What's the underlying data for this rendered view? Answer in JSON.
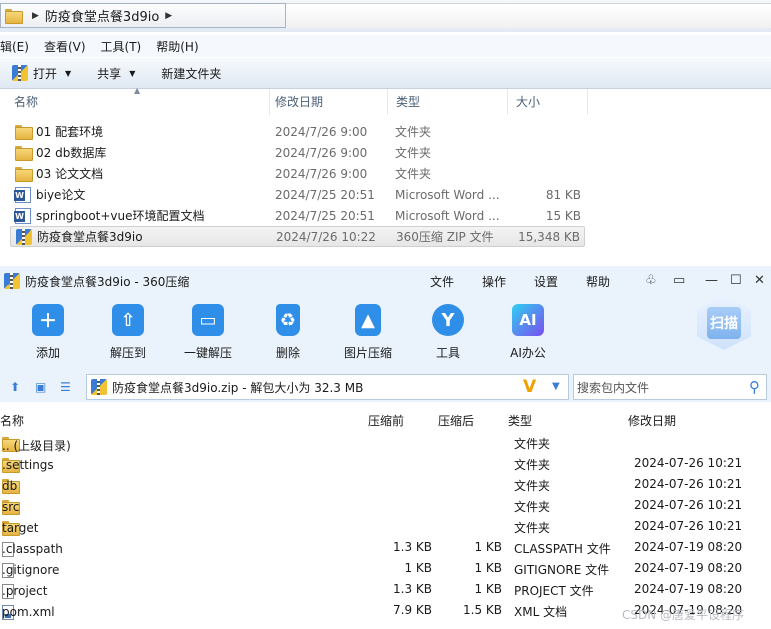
{
  "explorer": {
    "path": "防疫食堂点餐3d9io",
    "menu": [
      "辑(E)",
      "查看(V)",
      "工具(T)",
      "帮助(H)"
    ],
    "toolbar": {
      "open": "打开",
      "share": "共享",
      "new_folder": "新建文件夹"
    },
    "columns": {
      "name": "名称",
      "date": "修改日期",
      "type": "类型",
      "size": "大小"
    },
    "files": [
      {
        "name": "01 配套环境",
        "date": "2024/7/26 9:00",
        "type": "文件夹",
        "size": "",
        "icon": "folder-icon"
      },
      {
        "name": "02 db数据库",
        "date": "2024/7/26 9:00",
        "type": "文件夹",
        "size": "",
        "icon": "folder-icon"
      },
      {
        "name": "03 论文文档",
        "date": "2024/7/26 9:00",
        "type": "文件夹",
        "size": "",
        "icon": "folder-icon"
      },
      {
        "name": "biye论文",
        "date": "2024/7/25 20:51",
        "type": "Microsoft Word ...",
        "size": "81 KB",
        "icon": "word-icon"
      },
      {
        "name": "springboot+vue环境配置文档",
        "date": "2024/7/25 20:51",
        "type": "Microsoft Word ...",
        "size": "15 KB",
        "icon": "word-icon"
      },
      {
        "name": "防疫食堂点餐3d9io",
        "date": "2024/7/26 10:22",
        "type": "360压缩 ZIP 文件",
        "size": "15,348 KB",
        "icon": "zip-icon"
      }
    ]
  },
  "zip_window": {
    "title": "防疫食堂点餐3d9io - 360压缩",
    "menu": [
      "文件",
      "操作",
      "设置",
      "帮助"
    ],
    "tools": [
      {
        "label": "添加",
        "icon": "add-icon",
        "color": "#2f8fe8"
      },
      {
        "label": "解压到",
        "icon": "extract-icon",
        "color": "#2f8fe8"
      },
      {
        "label": "一键解压",
        "icon": "one-click-extract-icon",
        "color": "#2f8fe8"
      },
      {
        "label": "删除",
        "icon": "trash-icon",
        "color": "#2f8fe8"
      },
      {
        "label": "图片压缩",
        "icon": "image-compress-icon",
        "color": "#2f8fe8"
      },
      {
        "label": "工具",
        "icon": "tools-icon",
        "color": "#2f8fe8"
      },
      {
        "label": "AI办公",
        "icon": "ai-icon",
        "color": "#6a5cf2"
      }
    ],
    "scan_label": "扫描",
    "path_text": "防疫食堂点餐3d9io.zip - 解包大小为 32.3 MB",
    "vip_text": "V",
    "search_placeholder": "搜索包内文件",
    "columns": {
      "name": "名称",
      "before": "压缩前",
      "after": "压缩后",
      "type": "类型",
      "modified": "修改日期"
    },
    "entries": [
      {
        "name": ".. (上级目录)",
        "before": "",
        "after": "",
        "type": "文件夹",
        "modified": "",
        "icon": "folder-icon"
      },
      {
        "name": ".settings",
        "before": "",
        "after": "",
        "type": "文件夹",
        "modified": "2024-07-26 10:21",
        "icon": "folder-icon"
      },
      {
        "name": "db",
        "before": "",
        "after": "",
        "type": "文件夹",
        "modified": "2024-07-26 10:21",
        "icon": "folder-icon"
      },
      {
        "name": "src",
        "before": "",
        "after": "",
        "type": "文件夹",
        "modified": "2024-07-26 10:21",
        "icon": "folder-icon"
      },
      {
        "name": "target",
        "before": "",
        "after": "",
        "type": "文件夹",
        "modified": "2024-07-26 10:21",
        "icon": "folder-icon"
      },
      {
        "name": ".classpath",
        "before": "1.3 KB",
        "after": "1 KB",
        "type": "CLASSPATH 文件",
        "modified": "2024-07-19 08:20",
        "icon": "file-icon"
      },
      {
        "name": ".gitignore",
        "before": "1 KB",
        "after": "1 KB",
        "type": "GITIGNORE 文件",
        "modified": "2024-07-19 08:20",
        "icon": "file-icon"
      },
      {
        "name": ".project",
        "before": "1.3 KB",
        "after": "1 KB",
        "type": "PROJECT 文件",
        "modified": "2024-07-19 08:20",
        "icon": "file-icon"
      },
      {
        "name": "pom.xml",
        "before": "7.9 KB",
        "after": "1.5 KB",
        "type": "XML 文档",
        "modified": "2024-07-19 08:20",
        "icon": "xml-icon"
      }
    ]
  },
  "watermark": "CSDN @唐爱平设程序"
}
